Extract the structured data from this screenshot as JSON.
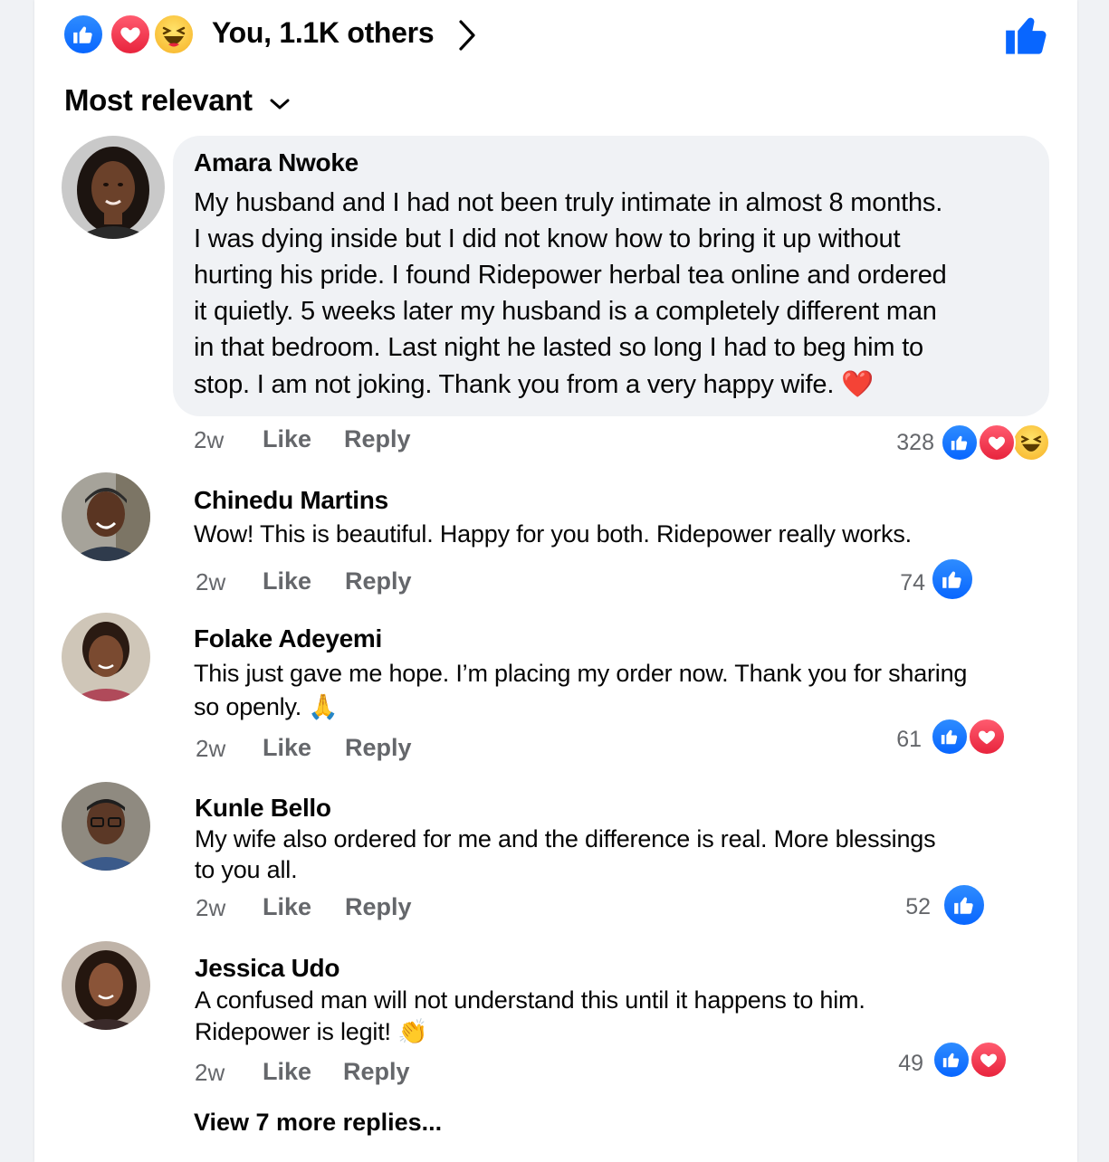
{
  "reactions_summary": {
    "icons": [
      "like-icon",
      "love-icon",
      "haha-icon"
    ],
    "text": "You, 1.1K others"
  },
  "sort": {
    "label": "Most relevant"
  },
  "colors": {
    "like": "#0866ff",
    "love": "#e8243d",
    "haha": "#f7b125",
    "meta_gray": "#65676b",
    "bubble": "#f0f2f5"
  },
  "comments": [
    {
      "name": "Amara Nwoke",
      "lines": [
        "My husband and I had not been truly intimate in almost 8 months.",
        "I was dying inside but I did not know how to bring it up without",
        "hurting his pride. I found Ridepower herbal tea online and ordered",
        "it quietly. 5 weeks later my husband is a completely different man",
        "in that bedroom. Last night he lasted so long I had to beg him to",
        "stop. I am not joking. Thank you from a very happy wife."
      ],
      "emoji": "❤️",
      "time": "2w",
      "like_label": "Like",
      "reply_label": "Reply",
      "reaction_count": "328",
      "reactions": [
        "like-icon",
        "love-icon",
        "haha-icon"
      ]
    },
    {
      "name": "Chinedu Martins",
      "lines": [
        "Wow! This is beautiful. Happy for you both. Ridepower really works."
      ],
      "time": "2w",
      "like_label": "Like",
      "reply_label": "Reply",
      "reaction_count": "74",
      "reactions": [
        "like-icon"
      ]
    },
    {
      "name": "Folake Adeyemi",
      "lines": [
        "This just gave me hope. I’m placing my order now. Thank you for sharing",
        "so openly."
      ],
      "emoji": "🙏",
      "time": "2w",
      "like_label": "Like",
      "reply_label": "Reply",
      "reaction_count": "61",
      "reactions": [
        "like-icon",
        "love-icon"
      ]
    },
    {
      "name": "Kunle Bello",
      "lines": [
        "My wife also ordered for me and the difference is real. More blessings",
        "to you all."
      ],
      "time": "2w",
      "like_label": "Like",
      "reply_label": "Reply",
      "reaction_count": "52",
      "reactions": [
        "like-icon"
      ]
    },
    {
      "name": "Jessica Udo",
      "lines": [
        "A confused man will not understand this until it happens to him.",
        "Ridepower is legit!"
      ],
      "emoji": "👏",
      "time": "2w",
      "like_label": "Like",
      "reply_label": "Reply",
      "reaction_count": "49",
      "reactions": [
        "like-icon",
        "love-icon"
      ]
    }
  ],
  "view_more": "View 7 more replies..."
}
